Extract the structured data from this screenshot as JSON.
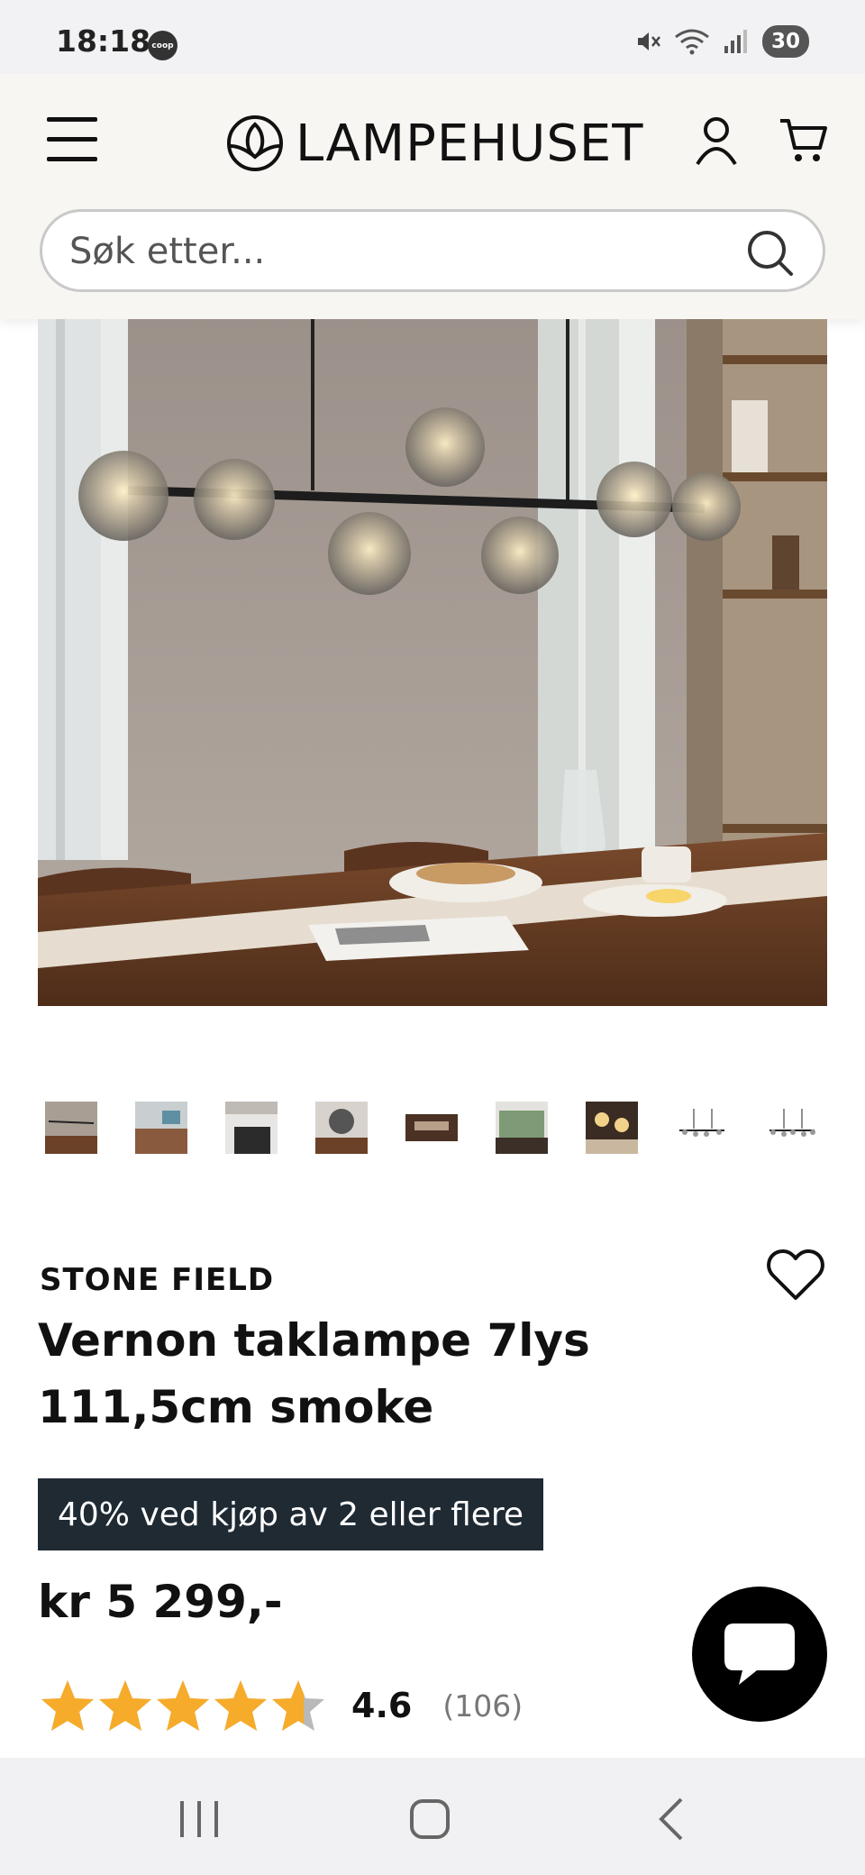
{
  "status_bar": {
    "time": "18:18",
    "carrier_badge": "coop",
    "battery": "30",
    "icons": [
      "mute-icon",
      "wifi-icon",
      "signal-icon"
    ]
  },
  "header": {
    "logo_text": "LAMPEHUSET",
    "search": {
      "placeholder": "Søk etter..."
    }
  },
  "product": {
    "brand": "STONE FIELD",
    "title": "Vernon taklampe 7lys 111,5cm smoke",
    "promo": "40% ved kjøp av 2 eller flere",
    "price": "kr 5 299,-",
    "rating": {
      "value": "4.6",
      "count": "(106)",
      "stars": 4.6,
      "max": 5
    },
    "thumbnail_count": 9
  },
  "colors": {
    "promo_bg": "#1f2a33",
    "star": "#f6ac2a",
    "star_empty": "#b9b9b9",
    "header_bg": "#f8f6f2"
  }
}
